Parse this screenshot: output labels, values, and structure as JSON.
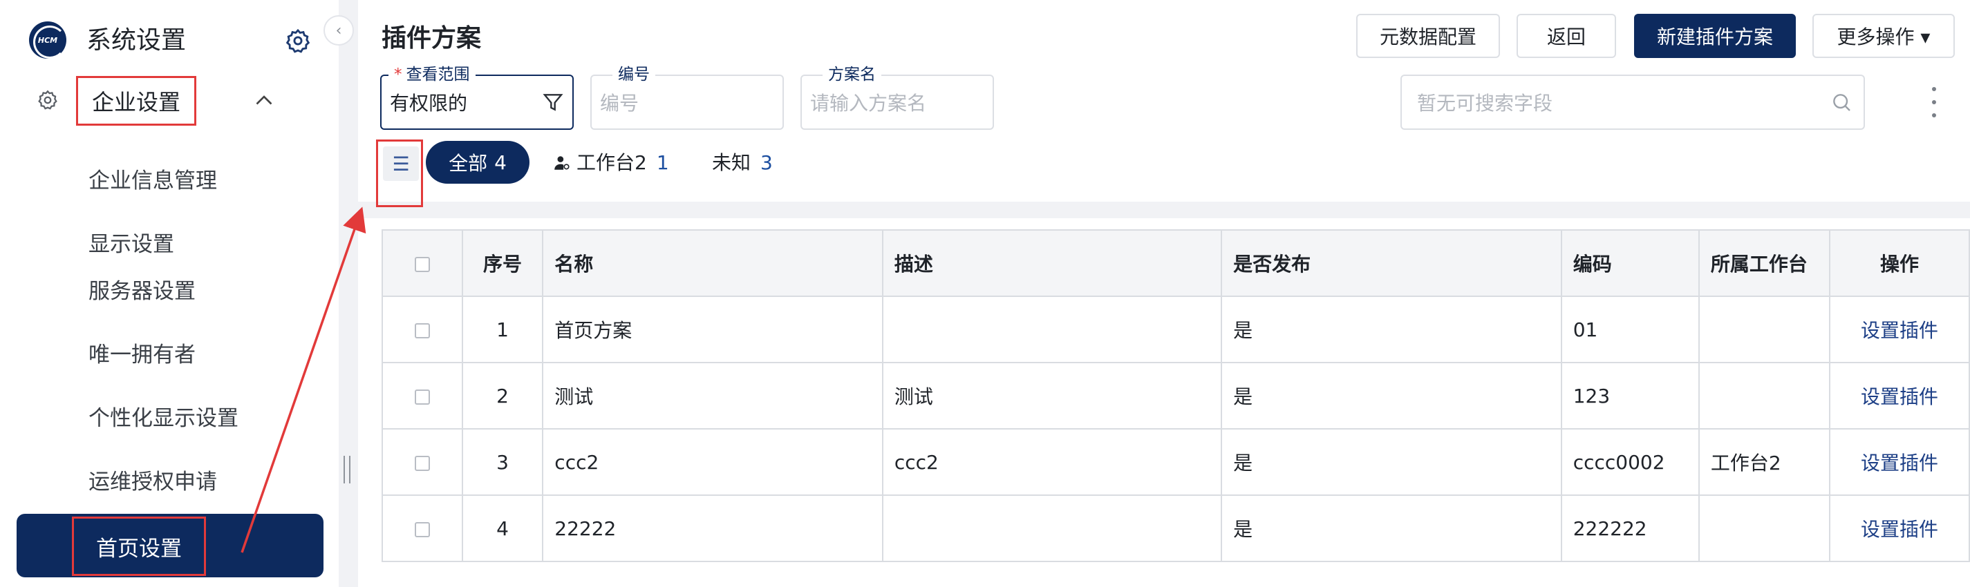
{
  "sidebar": {
    "logo_text": "HCM",
    "title": "系统设置",
    "menu_group": "企业设置",
    "items": [
      {
        "label": "企业信息管理"
      },
      {
        "label": "显示设置"
      },
      {
        "label": "服务器设置"
      },
      {
        "label": "唯一拥有者"
      },
      {
        "label": "个性化显示设置"
      },
      {
        "label": "运维授权申请"
      },
      {
        "label": "首页设置"
      }
    ]
  },
  "header": {
    "title": "插件方案",
    "buttons": {
      "metadata": "元数据配置",
      "back": "返回",
      "new": "新建插件方案",
      "more": "更多操作 ▾"
    }
  },
  "filters": {
    "scope": {
      "label": "查看范围",
      "required_mark": "*",
      "value": "有权限的"
    },
    "code": {
      "label": "编号",
      "placeholder": "编号"
    },
    "name": {
      "label": "方案名",
      "placeholder": "请输入方案名"
    },
    "search": {
      "placeholder": "暂无可搜索字段"
    }
  },
  "tabs": [
    {
      "label": "全部",
      "count": "4"
    },
    {
      "label": "工作台2",
      "count": "1"
    },
    {
      "label": "未知",
      "count": "3"
    }
  ],
  "table": {
    "headers": [
      "序号",
      "名称",
      "描述",
      "是否发布",
      "编码",
      "所属工作台",
      "操作"
    ],
    "rows": [
      {
        "no": "1",
        "name": "首页方案",
        "desc": "",
        "published": "是",
        "code": "01",
        "workbench": "",
        "action": "设置插件"
      },
      {
        "no": "2",
        "name": "测试",
        "desc": "测试",
        "published": "是",
        "code": "123",
        "workbench": "",
        "action": "设置插件"
      },
      {
        "no": "3",
        "name": "ccc2",
        "desc": "ccc2",
        "published": "是",
        "code": "cccc0002",
        "workbench": "工作台2",
        "action": "设置插件"
      },
      {
        "no": "4",
        "name": "22222",
        "desc": "",
        "published": "是",
        "code": "222222",
        "workbench": "",
        "action": "设置插件"
      }
    ]
  },
  "colors": {
    "primary": "#0d2a5e",
    "annotation": "#e23a3a",
    "link": "#1d3f86"
  }
}
